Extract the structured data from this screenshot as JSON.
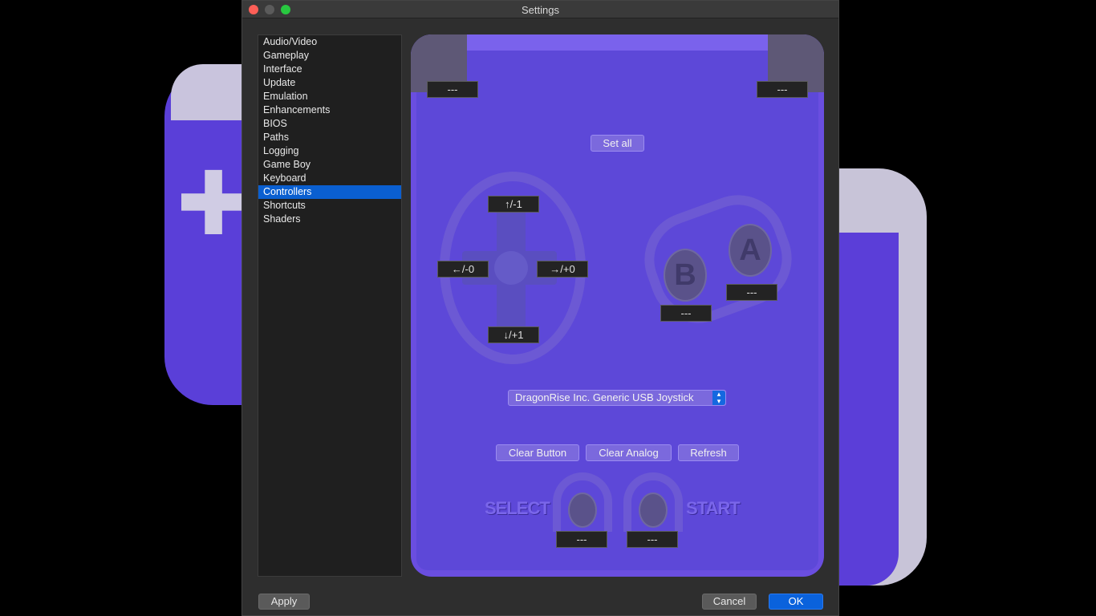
{
  "window": {
    "title": "Settings"
  },
  "sidebar": {
    "items": [
      {
        "label": "Audio/Video",
        "active": false
      },
      {
        "label": "Gameplay",
        "active": false
      },
      {
        "label": "Interface",
        "active": false
      },
      {
        "label": "Update",
        "active": false
      },
      {
        "label": "Emulation",
        "active": false
      },
      {
        "label": "Enhancements",
        "active": false
      },
      {
        "label": "BIOS",
        "active": false
      },
      {
        "label": "Paths",
        "active": false
      },
      {
        "label": "Logging",
        "active": false
      },
      {
        "label": "Game Boy",
        "active": false
      },
      {
        "label": "Keyboard",
        "active": false
      },
      {
        "label": "Controllers",
        "active": true
      },
      {
        "label": "Shortcuts",
        "active": false
      },
      {
        "label": "Shaders",
        "active": false
      }
    ]
  },
  "controller": {
    "l_binding": "---",
    "r_binding": "---",
    "set_all_label": "Set all",
    "up_binding": "↑/-1",
    "down_binding": "↓/+1",
    "left_binding": "←/-0",
    "right_binding": "→/+0",
    "a_label": "A",
    "a_binding": "---",
    "b_label": "B",
    "b_binding": "---",
    "joystick_selected": "DragonRise Inc. Generic USB Joystick",
    "clear_button_label": "Clear Button",
    "clear_analog_label": "Clear Analog",
    "refresh_label": "Refresh",
    "select_label": "SELECT",
    "select_binding": "---",
    "start_label": "START",
    "start_binding": "---"
  },
  "footer": {
    "apply_label": "Apply",
    "cancel_label": "Cancel",
    "ok_label": "OK"
  },
  "colors": {
    "accent": "#0a5fd0",
    "controller_body": "#5d48d8"
  }
}
